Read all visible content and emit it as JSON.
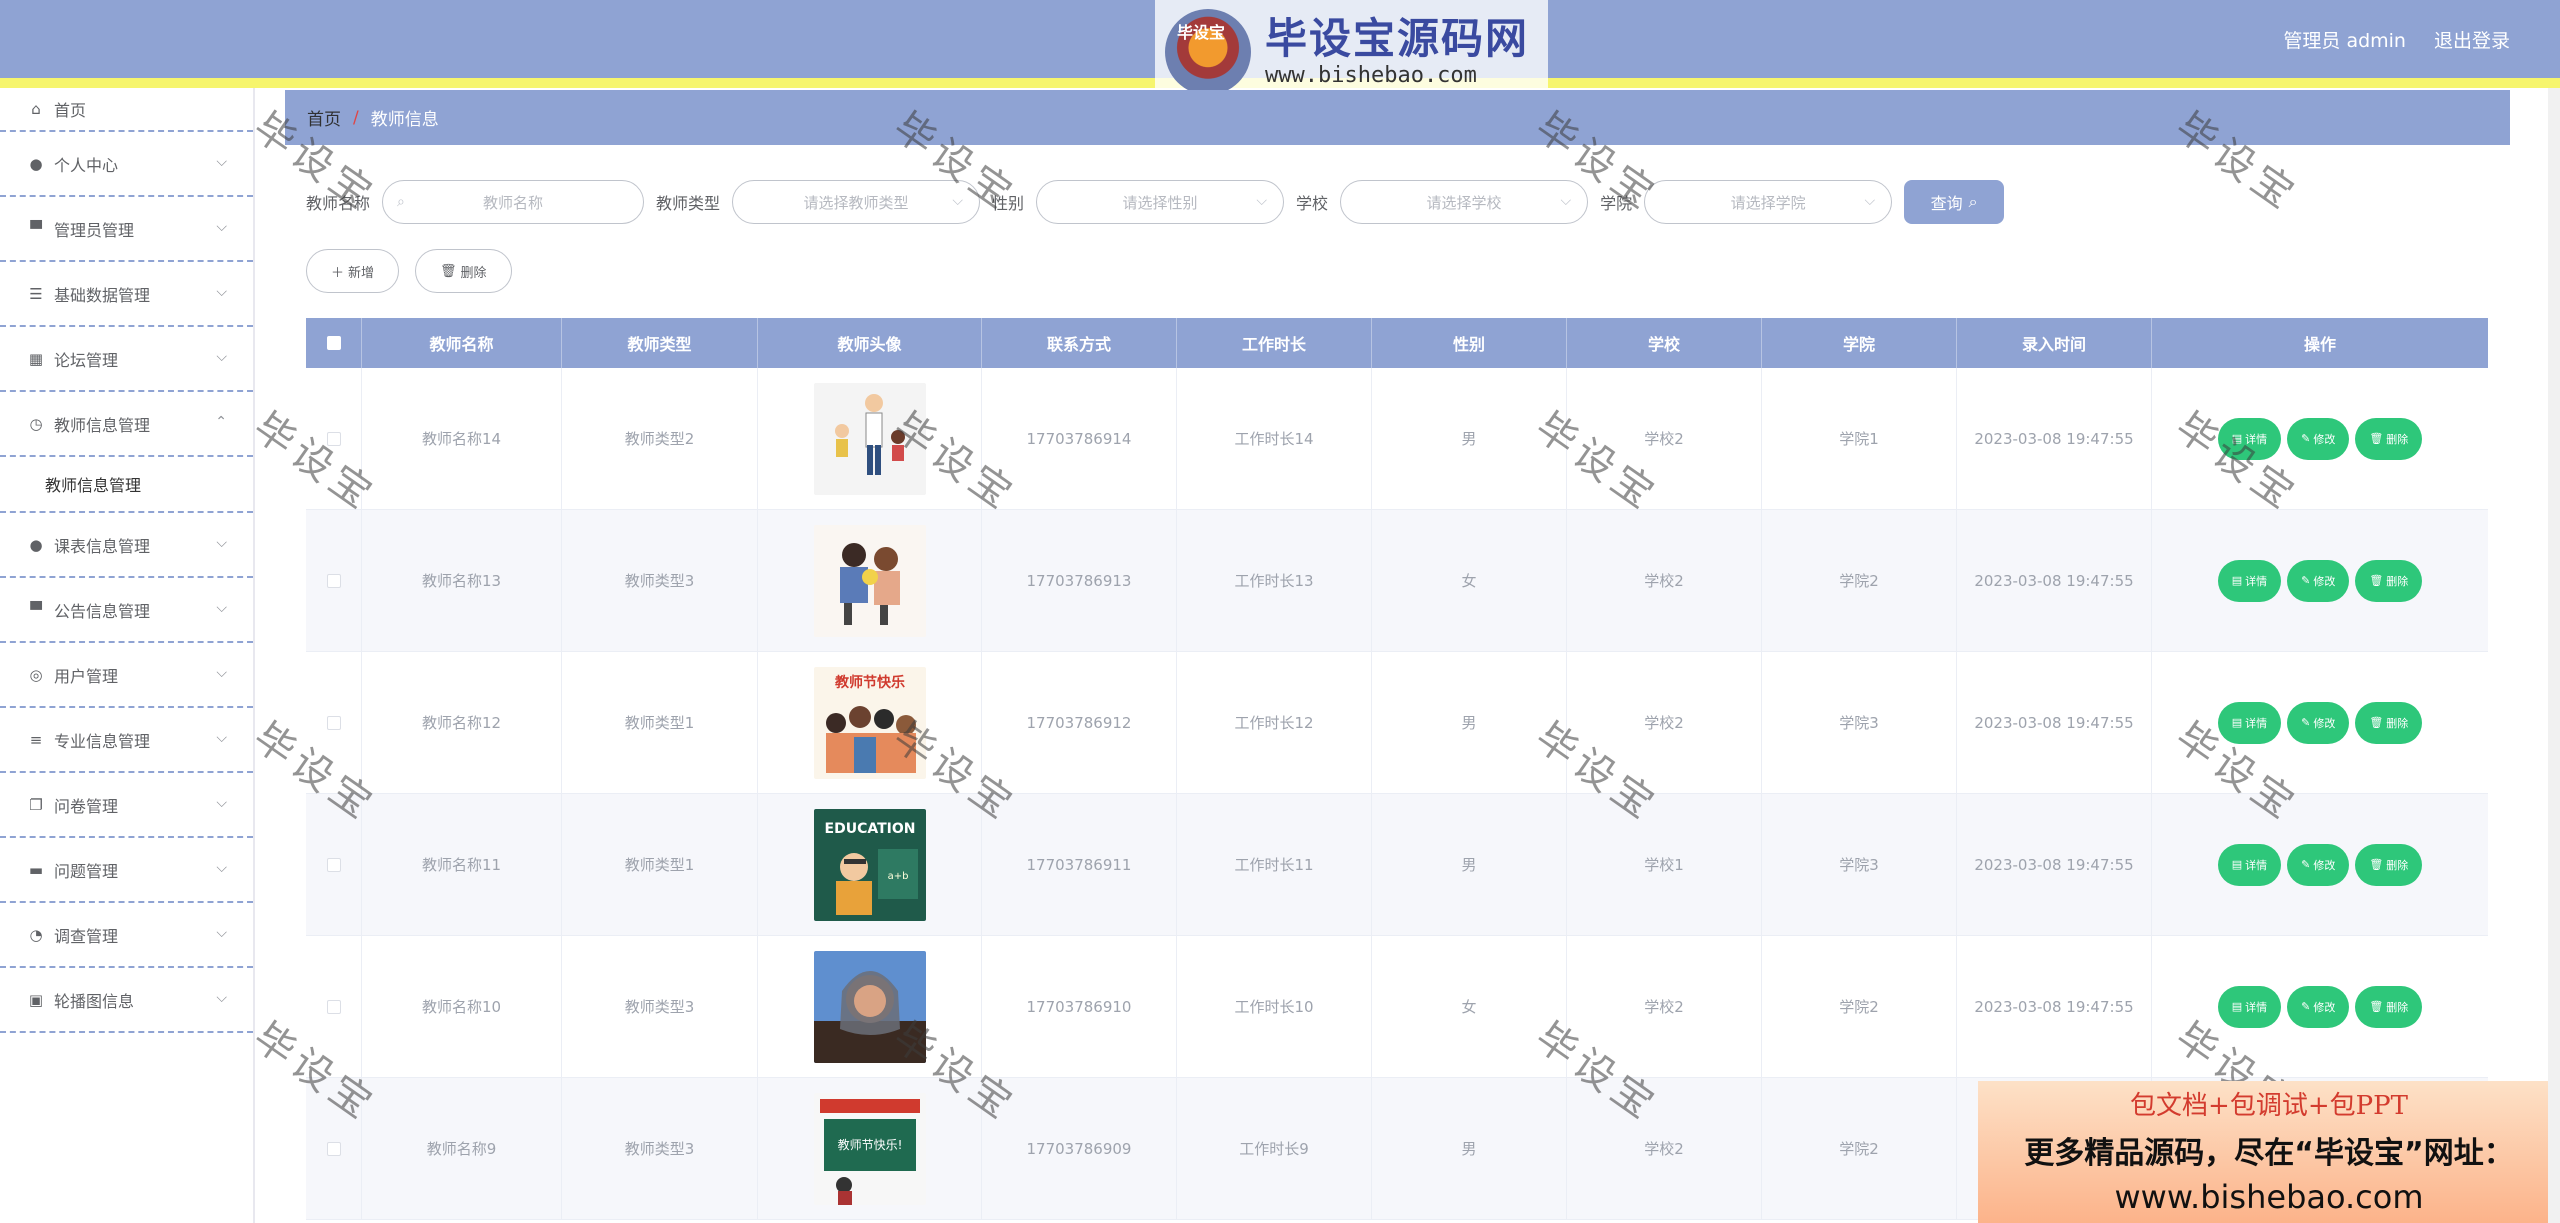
{
  "header": {
    "logo_badge": "毕设宝",
    "logo_cn": "毕设宝源码网",
    "logo_url": "www.bishebao.com",
    "admin_label": "管理员 admin",
    "logout_label": "退出登录"
  },
  "sidebar": {
    "items": [
      {
        "label": "首页",
        "icon": "home-icon"
      },
      {
        "label": "个人中心",
        "icon": "user-icon"
      },
      {
        "label": "管理员管理",
        "icon": "stamp-icon"
      },
      {
        "label": "基础数据管理",
        "icon": "sliders-icon"
      },
      {
        "label": "论坛管理",
        "icon": "grid-icon"
      },
      {
        "label": "教师信息管理",
        "icon": "compass-icon"
      },
      {
        "label": "课表信息管理",
        "icon": "user-icon"
      },
      {
        "label": "公告信息管理",
        "icon": "stamp-icon"
      },
      {
        "label": "用户管理",
        "icon": "headset-icon"
      },
      {
        "label": "专业信息管理",
        "icon": "list-icon"
      },
      {
        "label": "问卷管理",
        "icon": "copy-icon"
      },
      {
        "label": "问题管理",
        "icon": "chat-icon"
      },
      {
        "label": "调查管理",
        "icon": "gauge-icon"
      },
      {
        "label": "轮播图信息",
        "icon": "briefcase-icon"
      }
    ],
    "submenu_active": "教师信息管理"
  },
  "breadcrumb": {
    "home": "首页",
    "separator": "/",
    "current": "教师信息"
  },
  "filters": {
    "name_label": "教师名称",
    "name_placeholder": "教师名称",
    "type_label": "教师类型",
    "type_placeholder": "请选择教师类型",
    "gender_label": "性别",
    "gender_placeholder": "请选择性别",
    "school_label": "学校",
    "school_placeholder": "请选择学校",
    "college_label": "学院",
    "college_placeholder": "请选择学院",
    "query_label": "查询"
  },
  "actions": {
    "add_label": "新增",
    "delete_label": "删除"
  },
  "table": {
    "headers": [
      "教师名称",
      "教师类型",
      "教师头像",
      "联系方式",
      "工作时长",
      "性别",
      "学校",
      "学院",
      "录入时间",
      "操作"
    ],
    "op_labels": {
      "detail": "详情",
      "edit": "修改",
      "delete": "删除"
    },
    "rows": [
      {
        "name": "教师名称14",
        "type": "教师类型2",
        "phone": "17703786914",
        "duration": "工作时长14",
        "gender": "男",
        "school": "学校2",
        "college": "学院1",
        "time": "2023-03-08 19:47:55"
      },
      {
        "name": "教师名称13",
        "type": "教师类型3",
        "phone": "17703786913",
        "duration": "工作时长13",
        "gender": "女",
        "school": "学校2",
        "college": "学院2",
        "time": "2023-03-08 19:47:55"
      },
      {
        "name": "教师名称12",
        "type": "教师类型1",
        "phone": "17703786912",
        "duration": "工作时长12",
        "gender": "男",
        "school": "学校2",
        "college": "学院3",
        "time": "2023-03-08 19:47:55"
      },
      {
        "name": "教师名称11",
        "type": "教师类型1",
        "phone": "17703786911",
        "duration": "工作时长11",
        "gender": "男",
        "school": "学校1",
        "college": "学院3",
        "time": "2023-03-08 19:47:55"
      },
      {
        "name": "教师名称10",
        "type": "教师类型3",
        "phone": "17703786910",
        "duration": "工作时长10",
        "gender": "女",
        "school": "学校2",
        "college": "学院2",
        "time": "2023-03-08 19:47:55"
      },
      {
        "name": "教师名称9",
        "type": "教师类型3",
        "phone": "17703786909",
        "duration": "工作时长9",
        "gender": "男",
        "school": "学校2",
        "college": "学院2",
        "time": ""
      }
    ]
  },
  "watermark": "毕设宝",
  "promo": {
    "line1": "包文档+包调试+包PPT",
    "line2": "更多精品源码，尽在“毕设宝”网址：",
    "line3": "www.bishebao.com"
  },
  "colors": {
    "primary": "#8fa3d3",
    "stripe": "#f6f56d",
    "success": "#2ec77a",
    "danger": "#e04545"
  }
}
